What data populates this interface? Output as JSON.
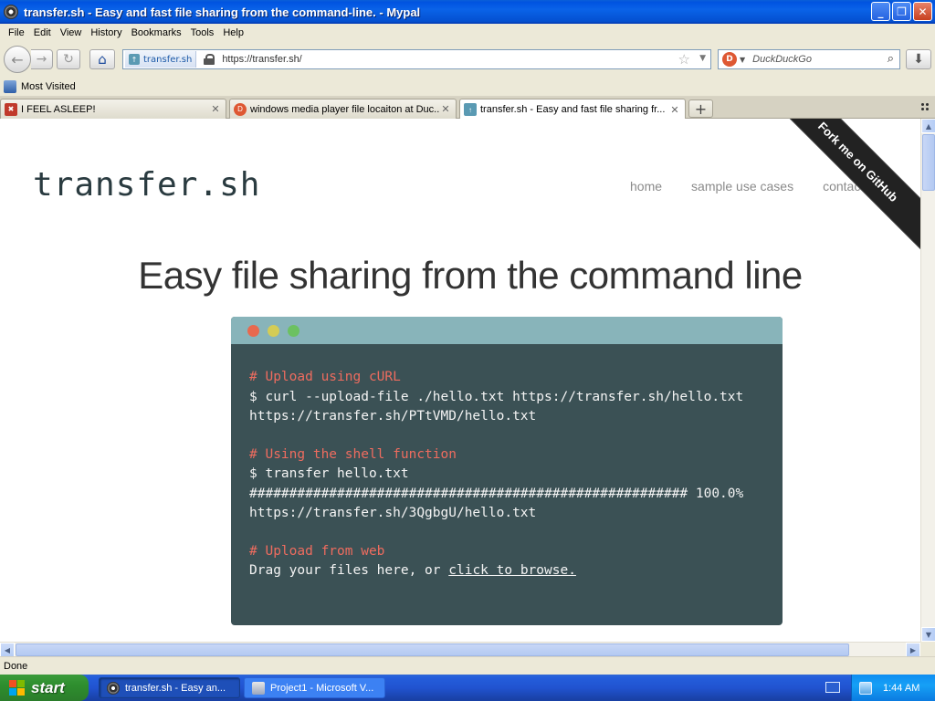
{
  "window": {
    "title": "transfer.sh - Easy and fast file sharing from the command-line. - Mypal",
    "buttons": {
      "minimize": "_",
      "maximize": "❐",
      "close": "✕"
    }
  },
  "menu": [
    "File",
    "Edit",
    "View",
    "History",
    "Bookmarks",
    "Tools",
    "Help"
  ],
  "nav": {
    "site_label": "transfer.sh",
    "url": "https://transfer.sh/",
    "search_placeholder": "DuckDuckGo"
  },
  "bookmarks": {
    "most_visited": "Most Visited"
  },
  "tabs": [
    {
      "label": "I FEEL ASLEEP!",
      "favicon_color": "#c0392b"
    },
    {
      "label": "windows media player file locaiton at Duc...",
      "favicon_color": "#de5833"
    },
    {
      "label": "transfer.sh - Easy and fast file sharing fr...",
      "favicon_color": "#5a9ab3",
      "active": true
    }
  ],
  "site": {
    "logo": "transfer.sh",
    "nav": [
      "home",
      "sample use cases",
      "contact us"
    ],
    "ribbon": "Fork me on GitHub",
    "headline": "Easy file sharing from the command line",
    "terminal": {
      "comment1": "# Upload using cURL",
      "line1": "$ curl --upload-file ./hello.txt https://transfer.sh/hello.txt",
      "line2": "https://transfer.sh/PTtVMD/hello.txt",
      "comment2": "# Using the shell function",
      "line3": "$ transfer hello.txt",
      "line4": "####################################################### 100.0%",
      "line5": "https://transfer.sh/3QgbgU/hello.txt",
      "comment3": "# Upload from web",
      "line6_prefix": "Drag your files here, or ",
      "line6_link": "click to browse."
    },
    "dot_colors": [
      "#e8694e",
      "#d4cc55",
      "#6cc161"
    ]
  },
  "status": {
    "text": "Done"
  },
  "taskbar": {
    "start": "start",
    "items": [
      {
        "label": "transfer.sh - Easy an...",
        "active": true
      },
      {
        "label": "Project1 - Microsoft V...",
        "active": false
      }
    ],
    "clock": "1:44 AM"
  }
}
